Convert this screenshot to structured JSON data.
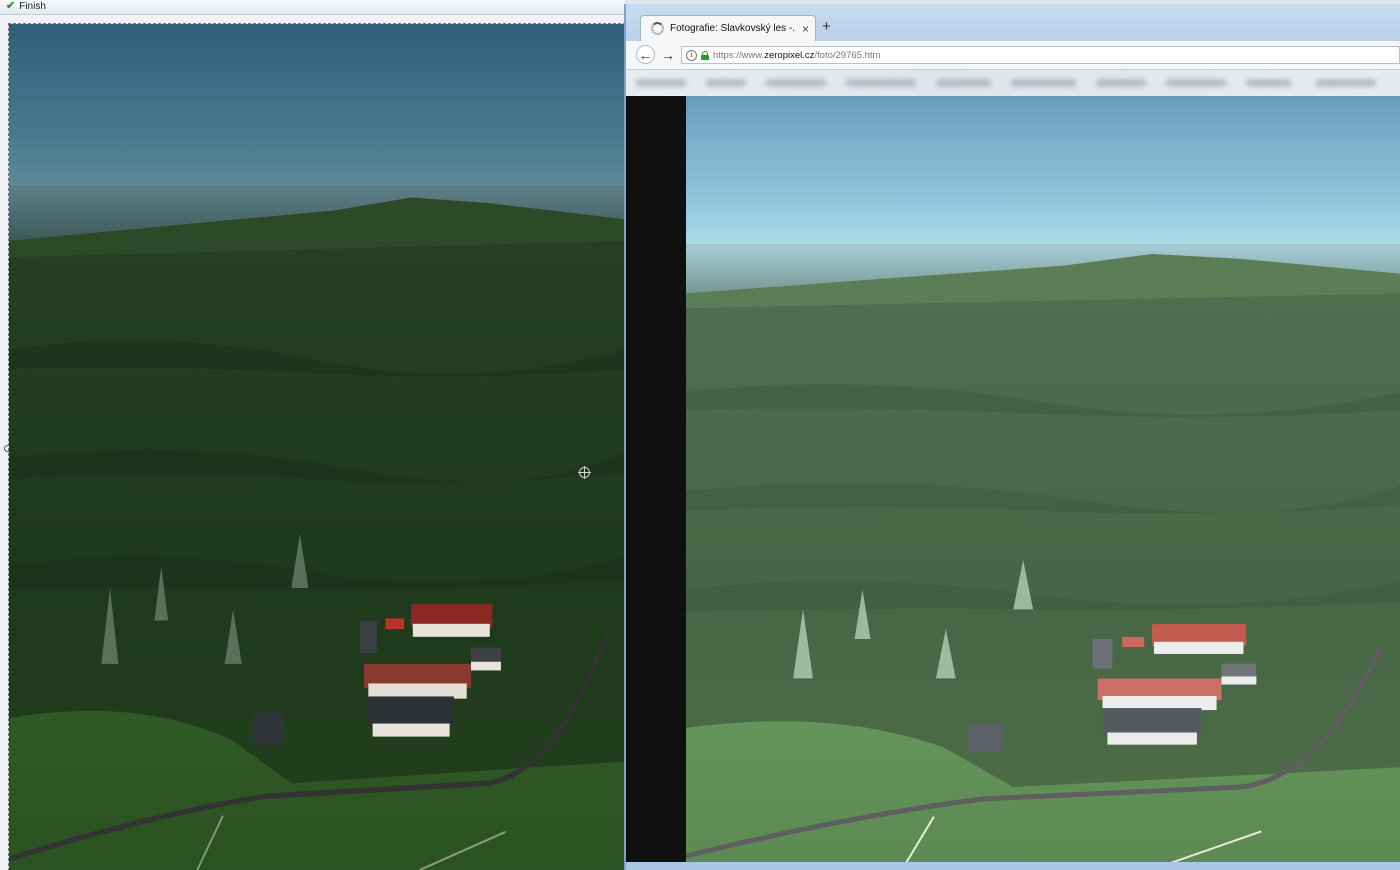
{
  "editor": {
    "finish_label": "Finish",
    "photo_tone": "dark-saturated"
  },
  "browser": {
    "tab": {
      "title": "Fotografie: Slavkovský les -...",
      "close": "×"
    },
    "new_tab": "+",
    "nav": {
      "back": "←",
      "forward": "→"
    },
    "url": {
      "prefix": "https://www.",
      "host": "zeropixel.cz",
      "path": "/foto/29765.htm"
    },
    "photo_tone": "light-faded"
  },
  "colors": {
    "finish_check": "#2a9a2a",
    "secure_lock": "#2a9a2a",
    "window_frame": "#a9c5e4"
  },
  "icons": [
    "check-icon",
    "loading-spinner-icon",
    "close-icon",
    "plus-icon",
    "back-arrow-icon",
    "forward-arrow-icon",
    "info-icon",
    "lock-icon",
    "crosshair-icon"
  ]
}
